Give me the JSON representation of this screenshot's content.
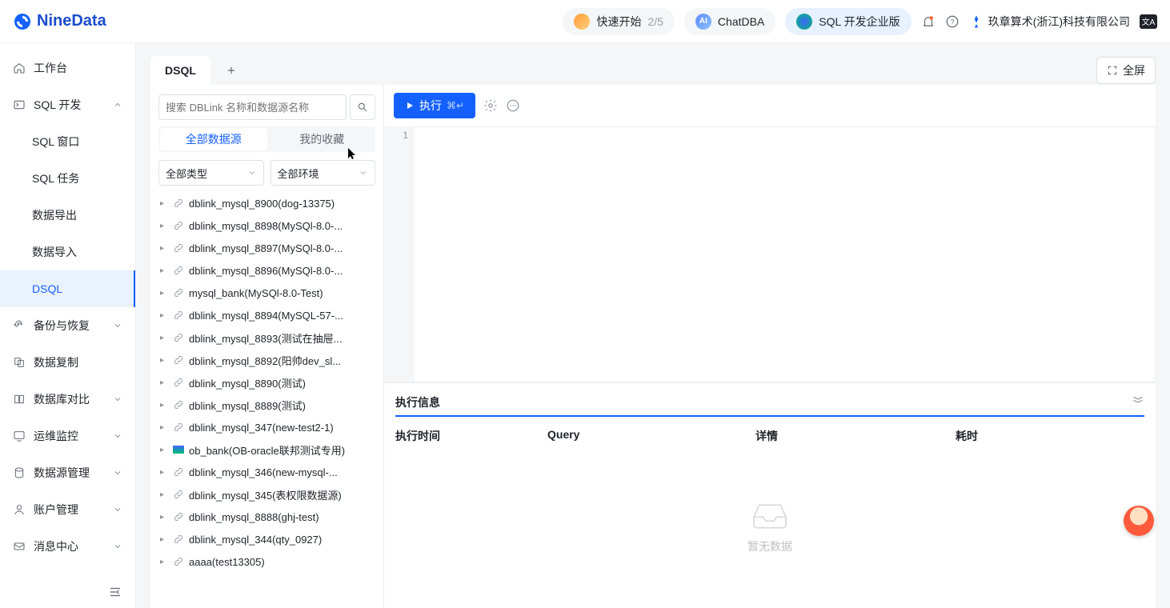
{
  "brand": "NineData",
  "header": {
    "quickstart": {
      "label": "快速开始",
      "progress": "2/5"
    },
    "chatdba": "ChatDBA",
    "edition": "SQL 开发企业版",
    "org": "玖章算术(浙江)科技有限公司",
    "lang_badge": "文A"
  },
  "sidebar": {
    "workspace": "工作台",
    "sql_dev": "SQL 开发",
    "sql_dev_children": [
      "SQL 窗口",
      "SQL 任务",
      "数据导出",
      "数据导入",
      "DSQL"
    ],
    "backup": "备份与恢复",
    "replicate": "数据复制",
    "compare": "数据库对比",
    "monitor": "运维监控",
    "datasource": "数据源管理",
    "account": "账户管理",
    "message": "消息中心"
  },
  "tabs": {
    "active": "DSQL"
  },
  "fullscreen": "全屏",
  "tree": {
    "search_placeholder": "搜索 DBLink 名称和数据源名称",
    "tab_all": "全部数据源",
    "tab_fav": "我的收藏",
    "filter_type": "全部类型",
    "filter_env": "全部环境",
    "items": [
      "dblink_mysql_8900(dog-13375)",
      "dblink_mysql_8898(MySQl-8.0-...",
      "dblink_mysql_8897(MySQl-8.0-...",
      "dblink_mysql_8896(MySQl-8.0-...",
      "mysql_bank(MySQl-8.0-Test)",
      "dblink_mysql_8894(MySQL-57-...",
      "dblink_mysql_8893(测试在抽屉...",
      "dblink_mysql_8892(阳帅dev_sl...",
      "dblink_mysql_8890(测试)",
      "dblink_mysql_8889(测试)",
      "dblink_mysql_347(new-test2-1)",
      "ob_bank(OB-oracle联邦测试专用)",
      "dblink_mysql_346(new-mysql-...",
      "dblink_mysql_345(表权限数据源)",
      "dblink_mysql_8888(ghj-test)",
      "dblink_mysql_344(qty_0927)",
      "aaaa(test13305)"
    ],
    "ob_index": 11
  },
  "editor": {
    "run": "执行",
    "shortcut": "⌘↵",
    "line1": "1"
  },
  "result": {
    "title": "执行信息",
    "cols": [
      "执行时间",
      "Query",
      "详情",
      "耗时"
    ],
    "empty": "暂无数据"
  }
}
